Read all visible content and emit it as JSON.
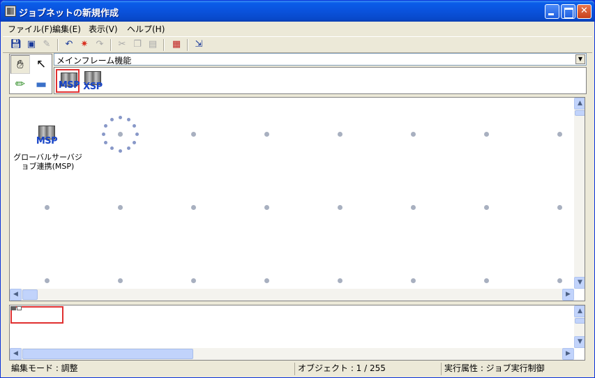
{
  "window": {
    "title": "ジョブネットの新規作成"
  },
  "menu": [
    "ファイル(F)",
    "編集(E)",
    "表示(V)",
    "ヘルプ(H)"
  ],
  "toolbar": {
    "icons": [
      "save-icon",
      "save-as-icon",
      "brush-icon",
      "undo-icon",
      "redraw-icon",
      "redo-icon",
      "cut-icon",
      "copy-icon",
      "paste-icon",
      "calendar-icon",
      "export-icon"
    ]
  },
  "palette": {
    "selected": "hand-tool",
    "tools": [
      "hand-tool",
      "select-tool",
      "pencil-tool",
      "eraser-tool"
    ]
  },
  "category": {
    "selected": "メインフレーム機能"
  },
  "components": [
    {
      "label": "MSP",
      "selected": true
    },
    {
      "label": "XSP",
      "selected": false
    }
  ],
  "canvas": {
    "node": {
      "icon_label": "MSP",
      "label": "グローバルサーバジョブ連携(MSP)"
    }
  },
  "statusbar": {
    "mode": "編集モード : 調整",
    "objects": "オブジェクト : 1 / 255",
    "attribute": "実行属性 : ジョブ実行制御"
  },
  "colors": {
    "title_bar": "#0a52dc",
    "selection": "#e03030",
    "component_label": "#1a46c8"
  }
}
